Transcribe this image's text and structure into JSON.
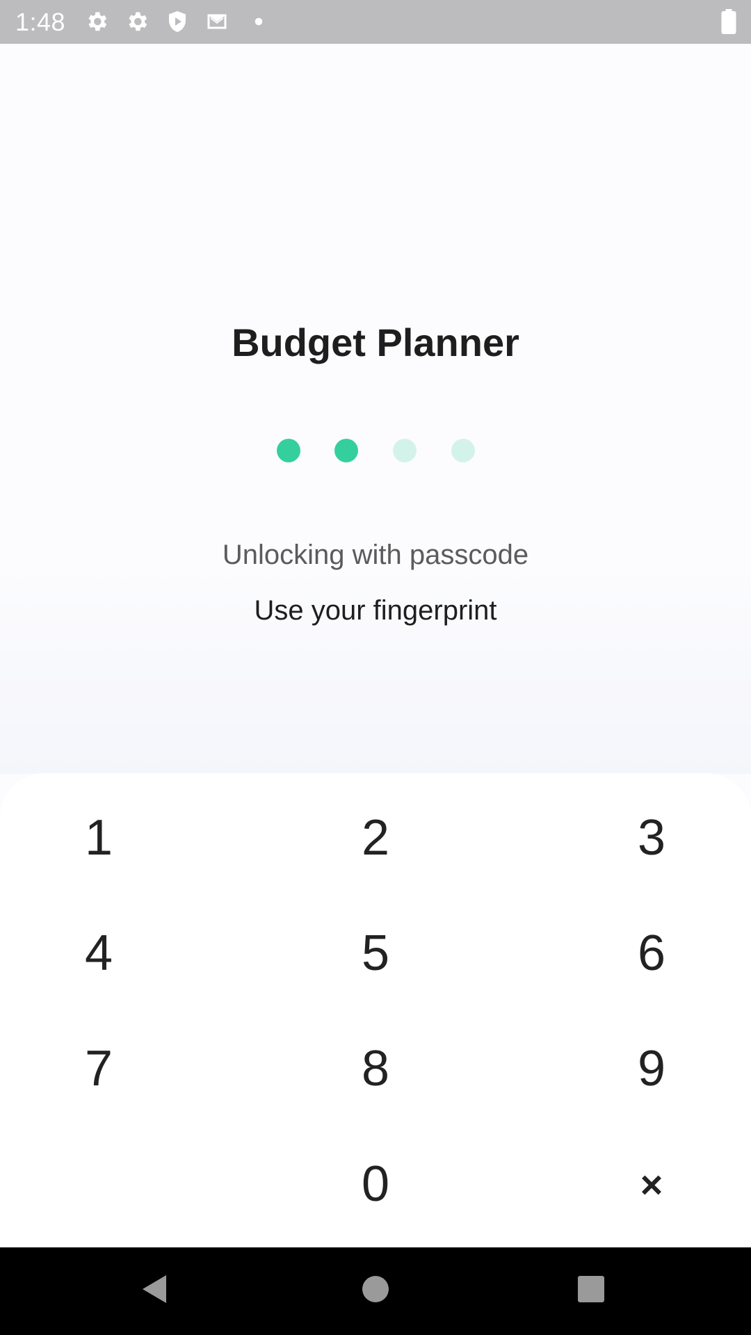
{
  "status_bar": {
    "time": "1:48",
    "icons": [
      "gear-icon",
      "gear-icon",
      "shield-play-icon",
      "mail-icon",
      "dot-icon",
      "battery-icon"
    ]
  },
  "app": {
    "title": "Budget Planner"
  },
  "passcode": {
    "length": 4,
    "entered": 2,
    "filled_color": "#35cf9d",
    "empty_color": "#d3f3ea"
  },
  "status_text": "Unlocking with passcode",
  "fingerprint_label": "Use your fingerprint",
  "keypad": {
    "keys": [
      "1",
      "2",
      "3",
      "4",
      "5",
      "6",
      "7",
      "8",
      "9",
      "",
      "0",
      "×"
    ]
  },
  "nav_bar": {
    "buttons": [
      "back-icon",
      "home-icon",
      "recents-icon"
    ]
  }
}
